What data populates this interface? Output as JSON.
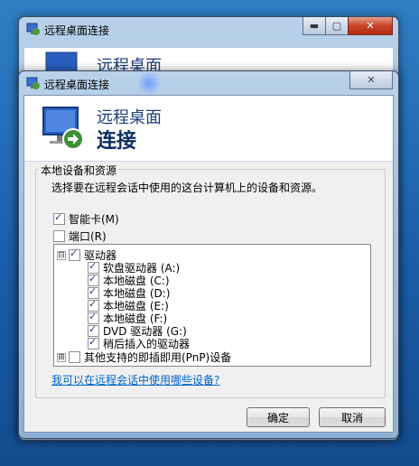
{
  "back_window": {
    "title": "远程桌面连接",
    "header_line1": "远程桌面"
  },
  "dialog": {
    "title": "远程桌面连接",
    "close_glyph": "✕",
    "header_line1": "远程桌面",
    "header_line2": "连接",
    "group_label": "本地设备和资源",
    "instruction": "选择要在远程会话中使用的这台计算机上的设备和资源。",
    "smart_card": {
      "label": "智能卡(M)",
      "checked": true
    },
    "ports": {
      "label": "端口(R)",
      "checked": false
    },
    "drives_node": {
      "label": "驱动器",
      "expander": "⊟",
      "checked": true
    },
    "drives": [
      {
        "label": "软盘驱动器 (A:)",
        "checked": true
      },
      {
        "label": "本地磁盘 (C:)",
        "checked": true
      },
      {
        "label": "本地磁盘 (D:)",
        "checked": true
      },
      {
        "label": "本地磁盘 (E:)",
        "checked": true
      },
      {
        "label": "本地磁盘 (F:)",
        "checked": true
      },
      {
        "label": "DVD 驱动器 (G:)",
        "checked": true
      },
      {
        "label": "稍后插入的驱动器",
        "checked": true
      }
    ],
    "pnp_node": {
      "label": "其他支持的即插即用(PnP)设备",
      "expander": "⊞",
      "checked": false
    },
    "help_link": "我可以在远程会话中使用哪些设备?",
    "ok_label": "确定",
    "cancel_label": "取消"
  }
}
